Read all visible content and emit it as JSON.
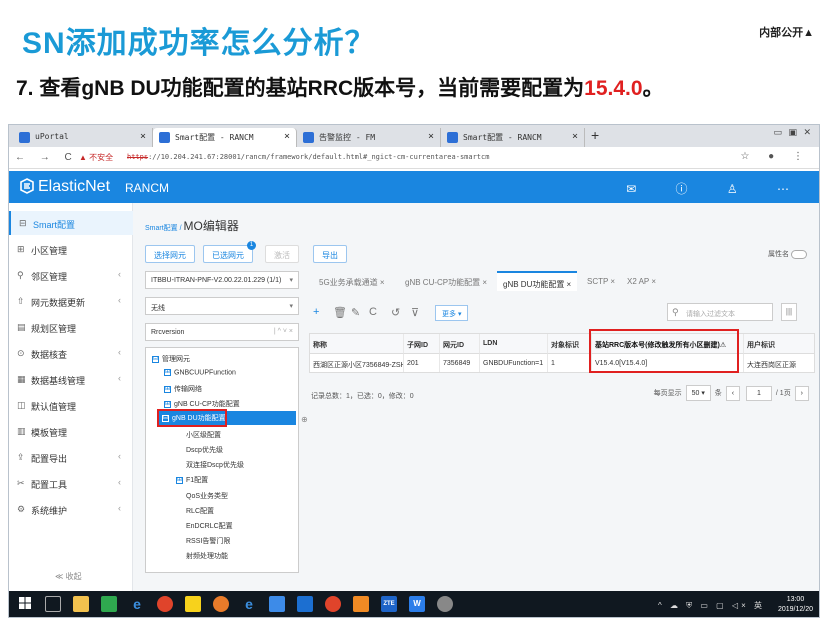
{
  "slide": {
    "title": "SN添加成功率怎么分析？",
    "corner_label": "内部公开▲",
    "step_text": "7. 查看gNB DU功能配置的基站RRC版本号，当前需要配置为",
    "step_value": "15.4.0",
    "step_end": "。"
  },
  "browser": {
    "tabs": [
      {
        "label": "uPortal"
      },
      {
        "label": "Smart配置 - RANCM"
      },
      {
        "label": "告警监控 - FM"
      },
      {
        "label": "Smart配置 - RANCM"
      }
    ],
    "nav_glyphs": "← → C",
    "security_warning": "▲ 不安全",
    "url_scheme": "https",
    "url_rest": "://10.204.241.67:28001/rancm/framework/default.html#_ngict-cm-currentarea-smartcm",
    "new_tab": "+",
    "window_controls": "▭ ▣ ✕",
    "right_icons": "☆ ● ⋮"
  },
  "app": {
    "logo": "ElasticNet",
    "name": "RANCM",
    "header_icons": "✉ ⓘ ♙ ⋯"
  },
  "sidebar": {
    "items": [
      {
        "icon": "⊟",
        "label": "Smart配置",
        "chev": ""
      },
      {
        "icon": "⊞",
        "label": "小区管理",
        "chev": ""
      },
      {
        "icon": "⚲",
        "label": "邻区管理",
        "chev": "‹"
      },
      {
        "icon": "⇧",
        "label": "网元数据更新",
        "chev": "‹"
      },
      {
        "icon": "▤",
        "label": "规划区管理",
        "chev": ""
      },
      {
        "icon": "⊙",
        "label": "数据核查",
        "chev": "‹"
      },
      {
        "icon": "▦",
        "label": "数据基线管理",
        "chev": "‹"
      },
      {
        "icon": "◫",
        "label": "默认值管理",
        "chev": ""
      },
      {
        "icon": "▥",
        "label": "模板管理",
        "chev": ""
      },
      {
        "icon": "⇪",
        "label": "配置导出",
        "chev": "‹"
      },
      {
        "icon": "✂",
        "label": "配置工具",
        "chev": "‹"
      },
      {
        "icon": "⚙",
        "label": "系统维护",
        "chev": "‹"
      }
    ],
    "collapse": "≪ 收起"
  },
  "content": {
    "breadcrumb_parent": "Smart配置",
    "breadcrumb_sep": " / ",
    "breadcrumb_current": "MO编辑器",
    "buttons": {
      "select_ne": "选择网元",
      "selected_ne": "已选网元",
      "selected_count": "1",
      "activate": "激活",
      "export": "导出"
    },
    "attr_label": "属性名",
    "ne_select": "ITBBU-ITRAN-PNF-V2.00.22.01.229 (1/1)",
    "filter_select": "无线",
    "search_value": "Rrcversion",
    "search_ctrl": "| ^ ˅ ×",
    "tree": [
      {
        "label": "管理网元",
        "box": "⊟",
        "kind": "root"
      },
      {
        "label": "GNBCUUPFunction",
        "box": "⊞",
        "kind": "l1"
      },
      {
        "label": "传输网络",
        "box": "⊞",
        "kind": "l1"
      },
      {
        "label": "gNB CU-CP功能配置",
        "box": "⊞",
        "kind": "l1"
      },
      {
        "label": "gNB DU功能配置",
        "box": "⊟",
        "kind": "sel"
      },
      {
        "label": "小区级配置",
        "box": "",
        "kind": "l2"
      },
      {
        "label": "Dscp优先级",
        "box": "",
        "kind": "l2"
      },
      {
        "label": "双连接Dscp优先级",
        "box": "",
        "kind": "l2"
      },
      {
        "label": "F1配置",
        "box": "⊞",
        "kind": "l2b"
      },
      {
        "label": "QoS业务类型",
        "box": "",
        "kind": "l2"
      },
      {
        "label": "RLC配置",
        "box": "",
        "kind": "l2"
      },
      {
        "label": "EnDCRLC配置",
        "box": "",
        "kind": "l2"
      },
      {
        "label": "RSSI告警门限",
        "box": "",
        "kind": "l2"
      },
      {
        "label": "射频处理功能",
        "box": "",
        "kind": "l2"
      }
    ],
    "object_tabs": [
      {
        "label": "5G业务承载通道 ×"
      },
      {
        "label": "gNB CU-CP功能配置 ×"
      },
      {
        "label": "gNB DU功能配置 ×"
      },
      {
        "label": "SCTP ×"
      },
      {
        "label": "X2 AP ×"
      }
    ],
    "toolbar": {
      "add": "+",
      "delete": "🗑",
      "edit": "✎",
      "refresh": "C",
      "undo": "↺",
      "filter": "⊽",
      "more": "更多 ▾",
      "filter_placeholder": "请输入过滤文本",
      "columns": "|||"
    },
    "grid": {
      "headers": [
        "称称",
        "子网ID",
        "网元ID",
        "LDN",
        "对象标识",
        "基站RRC版本号(修改触发所有小区删建)⚠",
        "用户标识"
      ],
      "row": [
        "西湖区正源小区7356849-ZSH",
        "201",
        "7356849",
        "GNBDUFunction=1",
        "1",
        "V15.4.0[V15.4.0]",
        "大连西岗区正源"
      ]
    },
    "summary": "记录总数：1，已选：0，修改：0",
    "pager": {
      "per_page_label": "每页显示",
      "per_page": "50 ▾",
      "unit": "条",
      "prev": "‹",
      "page": "1",
      "total": "/ 1页",
      "next": "›"
    }
  },
  "taskbar": {
    "tray": "^ ☁ ⛨ ▭ ▢ ◁× 英",
    "time": "13:00",
    "date": "2019/12/20"
  }
}
